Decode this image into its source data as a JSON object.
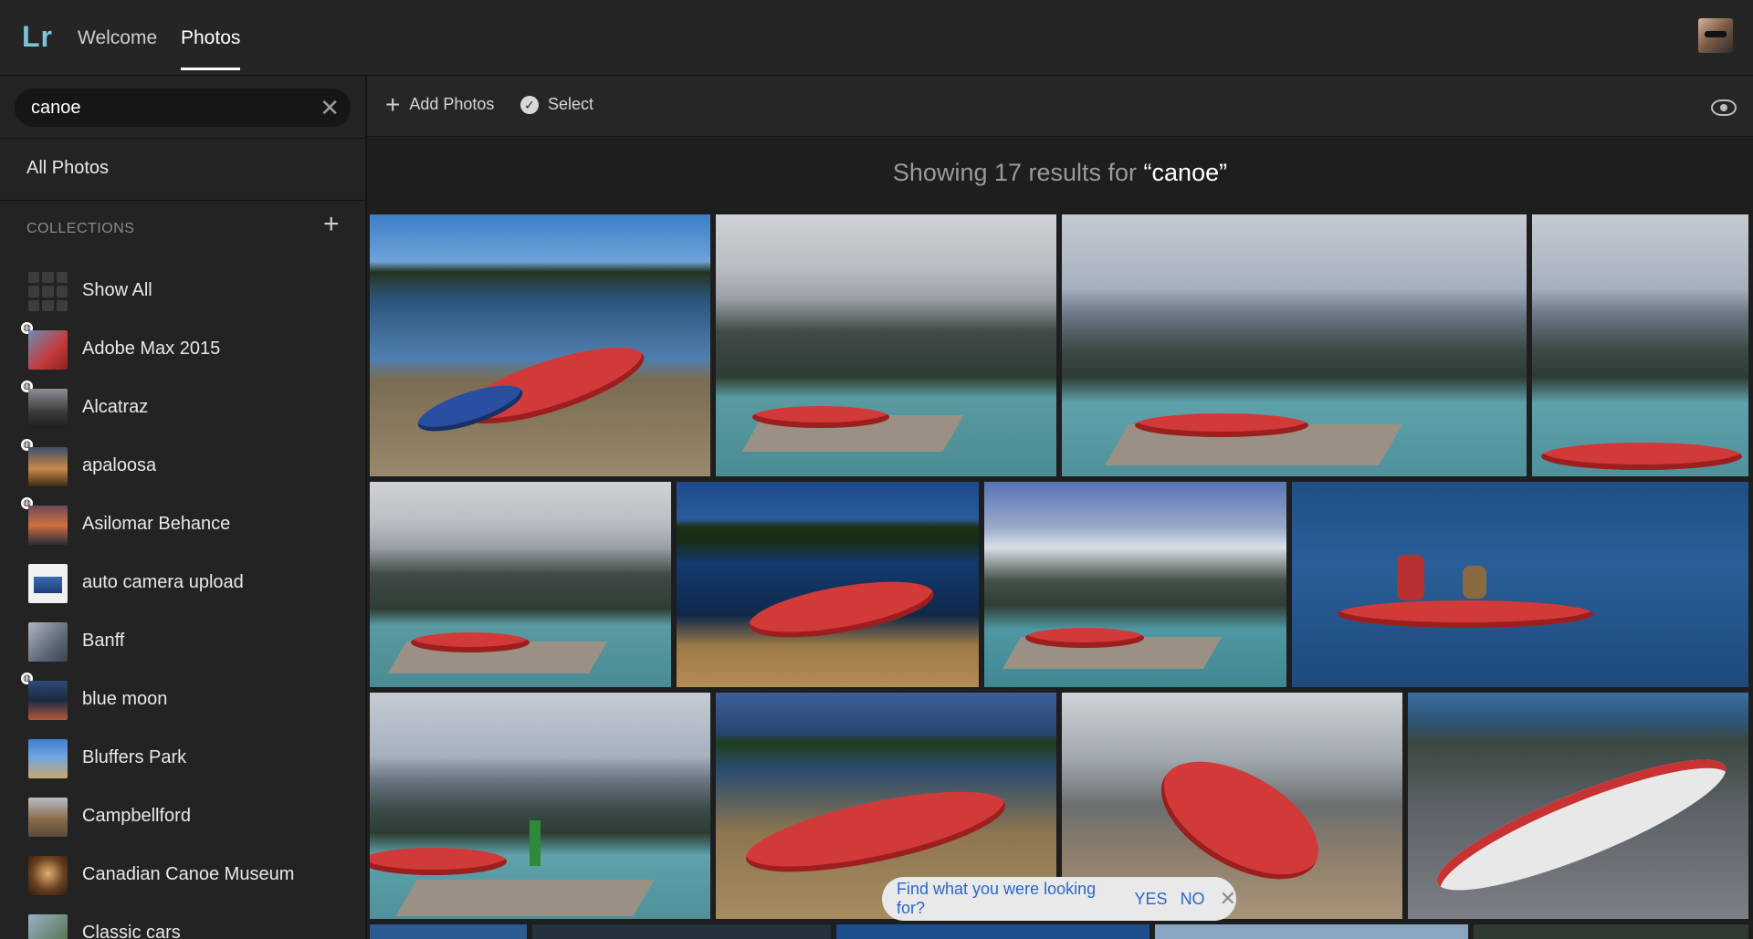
{
  "app": {
    "logo": "Lr"
  },
  "nav": {
    "tabs": [
      {
        "label": "Welcome"
      },
      {
        "label": "Photos"
      }
    ]
  },
  "search": {
    "value": "canoe"
  },
  "sidebar": {
    "all_photos": "All Photos",
    "collections_header": "COLLECTIONS",
    "items": [
      {
        "label": "Show All",
        "shared": false
      },
      {
        "label": "Adobe Max 2015",
        "shared": true
      },
      {
        "label": "Alcatraz",
        "shared": true
      },
      {
        "label": "apaloosa",
        "shared": true
      },
      {
        "label": "Asilomar Behance",
        "shared": true
      },
      {
        "label": "auto camera upload",
        "shared": false
      },
      {
        "label": "Banff",
        "shared": false
      },
      {
        "label": "blue moon",
        "shared": true
      },
      {
        "label": "Bluffers Park",
        "shared": false
      },
      {
        "label": "Campbellford",
        "shared": false
      },
      {
        "label": "Canadian Canoe Museum",
        "shared": false
      },
      {
        "label": "Classic cars",
        "shared": false
      }
    ]
  },
  "toolbar": {
    "add_photos": "Add Photos",
    "select": "Select"
  },
  "results": {
    "prefix": "Showing 17 results for ",
    "query": "“canoe”"
  },
  "feedback": {
    "question": "Find what you were looking for?",
    "yes": "YES",
    "no": "NO"
  },
  "colors": {
    "accent_blue": "#2a67c7",
    "canoe_red": "#d23a3a",
    "background": "#1e1e1e"
  },
  "icons": [
    "plus-icon",
    "check-circle-icon",
    "eye-icon",
    "close-icon",
    "globe-icon"
  ]
}
